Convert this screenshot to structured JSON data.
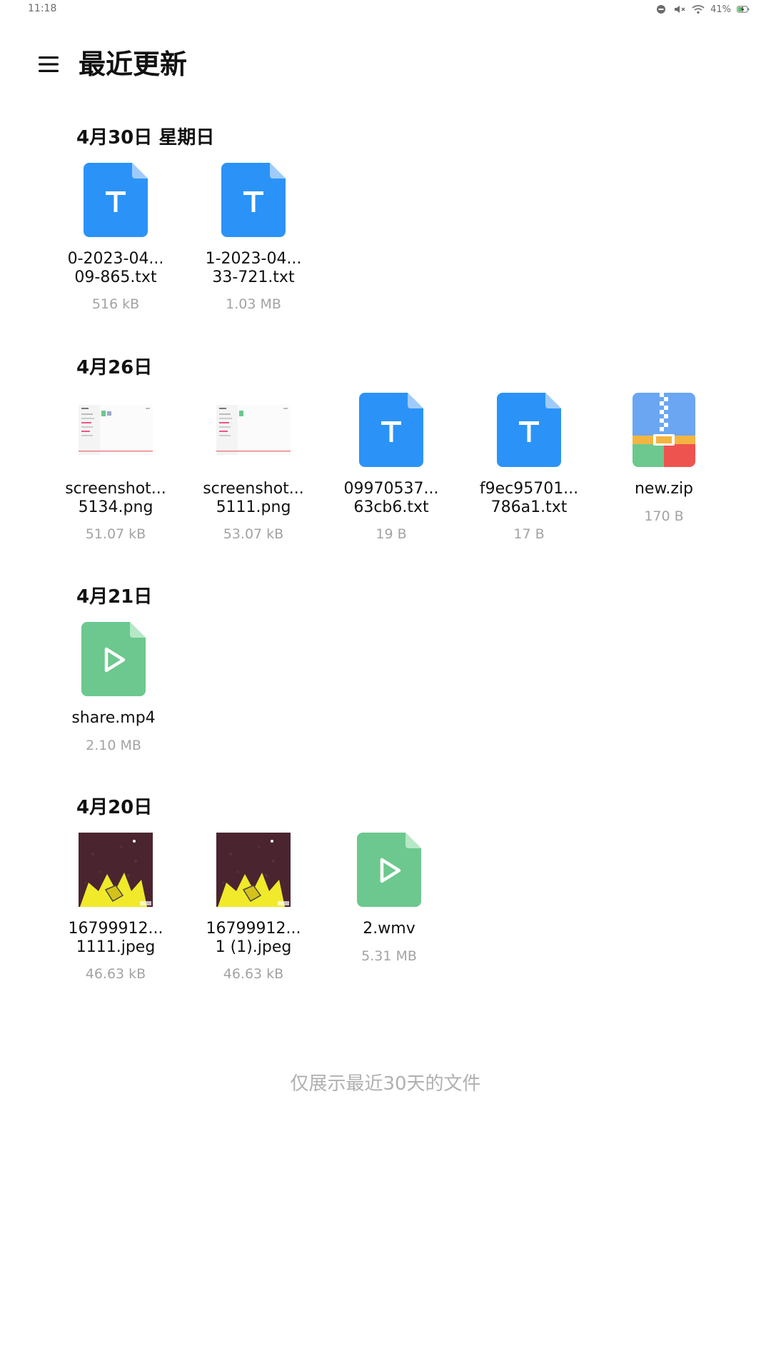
{
  "status_bar": {
    "time": "11:18",
    "battery": "41%",
    "icons": [
      "do-not-disturb-icon",
      "mute-icon",
      "wifi-icon",
      "battery-charging-icon"
    ]
  },
  "header": {
    "menu_icon": "menu-icon",
    "title": "最近更新"
  },
  "colors": {
    "doc_blue": "#2b93f7",
    "video_green": "#6cc88e",
    "zip_blue": "#6aa6f2",
    "zip_orange": "#f3b541",
    "zip_green": "#6cc88e",
    "zip_red": "#ef5350"
  },
  "groups": [
    {
      "date": "4月30日 星期日",
      "files": [
        {
          "line1": "0-2023-04...",
          "line2": "09-865.txt",
          "size": "516 kB",
          "type": "txt"
        },
        {
          "line1": "1-2023-04...",
          "line2": "33-721.txt",
          "size": "1.03 MB",
          "type": "txt"
        }
      ]
    },
    {
      "date": "4月26日",
      "files": [
        {
          "line1": "screenshot...",
          "line2": "5134.png",
          "size": "51.07 kB",
          "type": "png"
        },
        {
          "line1": "screenshot...",
          "line2": "5111.png",
          "size": "53.07 kB",
          "type": "png"
        },
        {
          "line1": "09970537...",
          "line2": "63cb6.txt",
          "size": "19 B",
          "type": "txt"
        },
        {
          "line1": "f9ec95701...",
          "line2": "786a1.txt",
          "size": "17 B",
          "type": "txt"
        },
        {
          "line1": "new.zip",
          "line2": "",
          "size": "170 B",
          "type": "zip"
        }
      ]
    },
    {
      "date": "4月21日",
      "files": [
        {
          "line1": "share.mp4",
          "line2": "",
          "size": "2.10 MB",
          "type": "video"
        }
      ]
    },
    {
      "date": "4月20日",
      "files": [
        {
          "line1": "16799912...",
          "line2": "1111.jpeg",
          "size": "46.63 kB",
          "type": "jpeg"
        },
        {
          "line1": "16799912...",
          "line2": "1 (1).jpeg",
          "size": "46.63 kB",
          "type": "jpeg"
        },
        {
          "line1": "2.wmv",
          "line2": "",
          "size": "5.31 MB",
          "type": "video"
        }
      ]
    }
  ],
  "footer_note": "仅展示最近30天的文件"
}
